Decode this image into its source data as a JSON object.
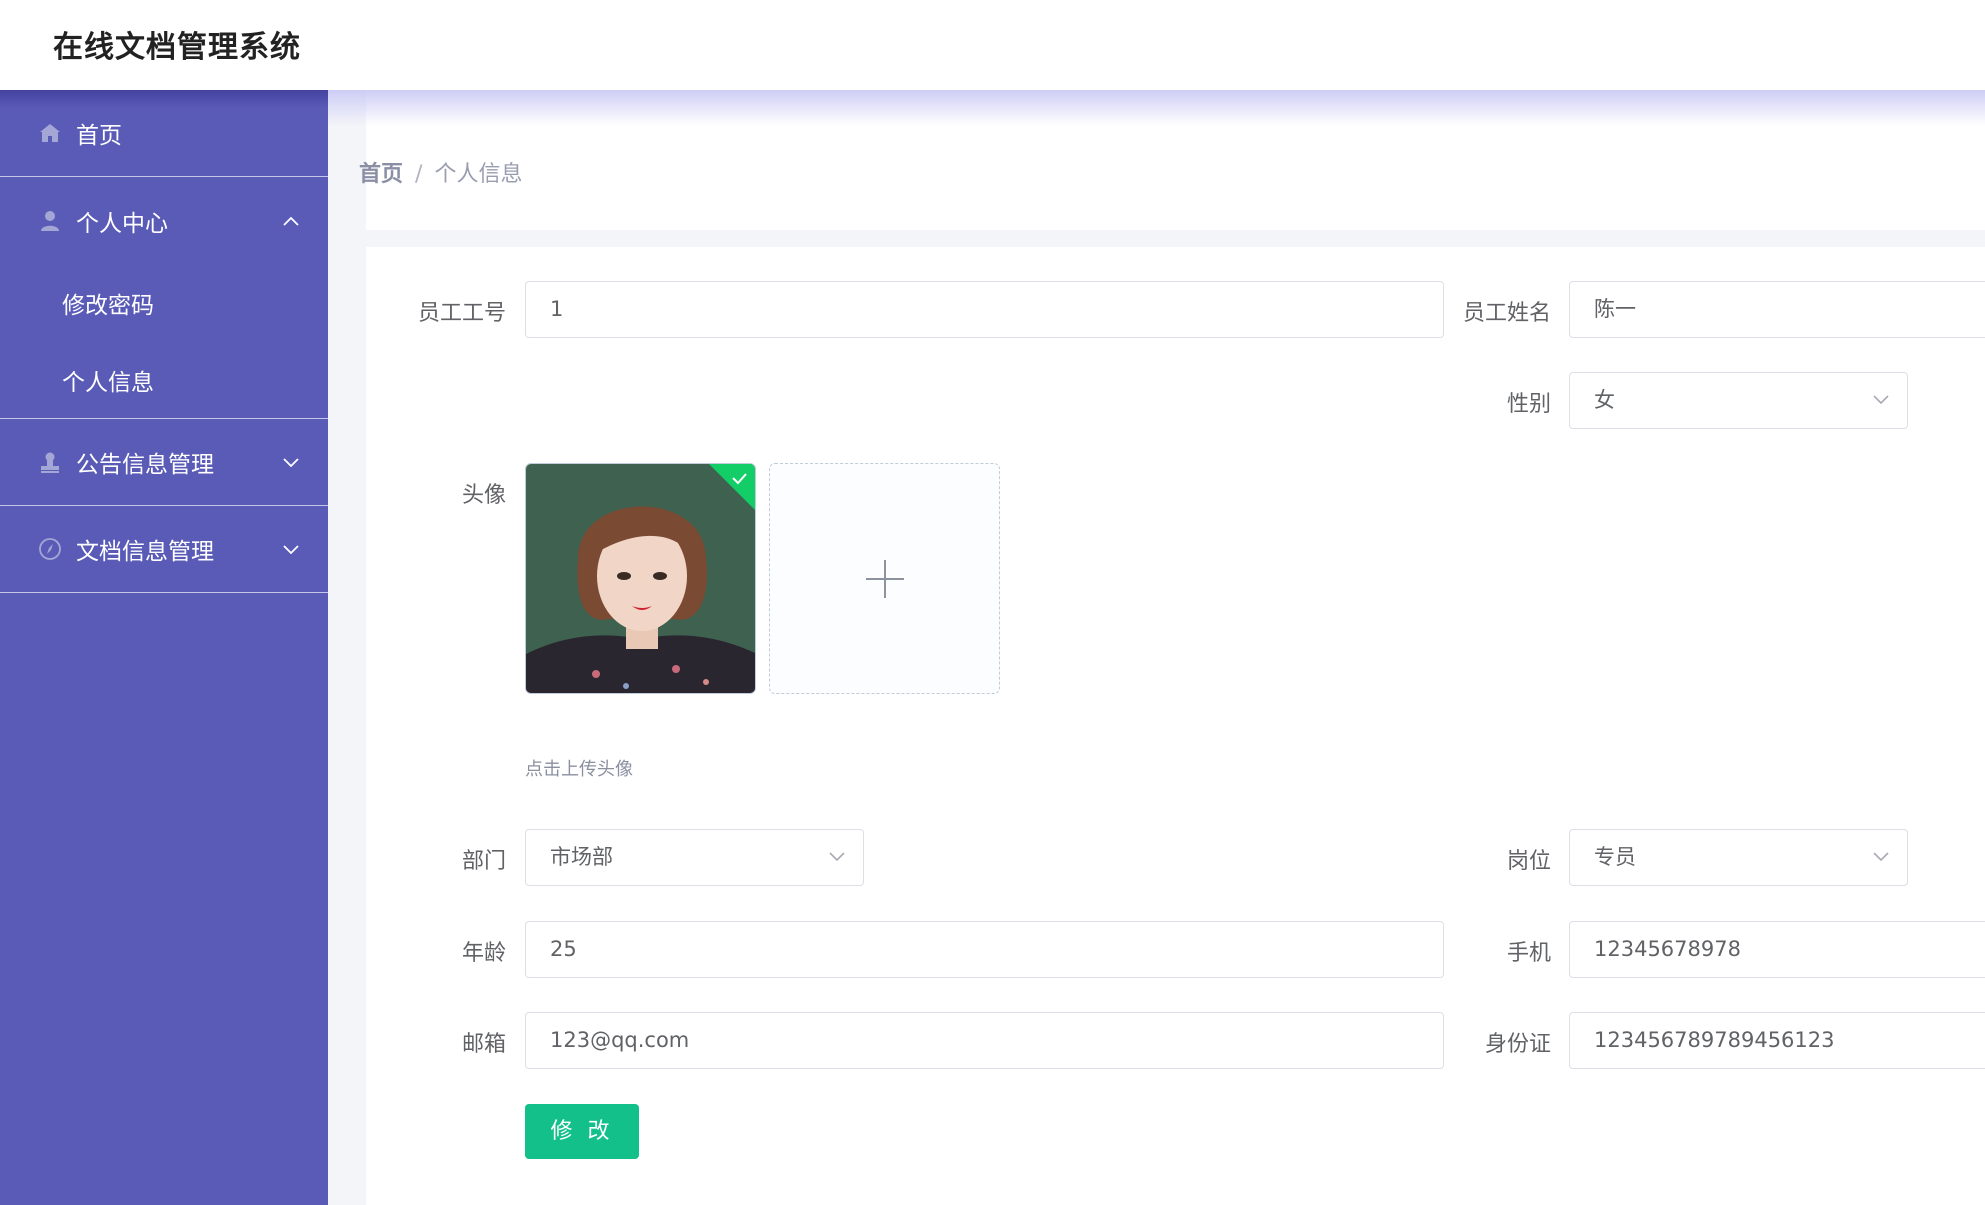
{
  "app": {
    "title": "在线文档管理系统"
  },
  "sidebar": {
    "items": [
      {
        "label": "首页",
        "icon": "home-icon"
      },
      {
        "label": "个人中心",
        "icon": "user-icon",
        "expanded": true,
        "children": [
          {
            "label": "修改密码"
          },
          {
            "label": "个人信息"
          }
        ]
      },
      {
        "label": "公告信息管理",
        "icon": "stamp-icon",
        "expanded": false
      },
      {
        "label": "文档信息管理",
        "icon": "compass-icon",
        "expanded": false
      }
    ]
  },
  "breadcrumb": {
    "home": "首页",
    "separator": "/",
    "current": "个人信息"
  },
  "form": {
    "employee_no": {
      "label": "员工工号",
      "value": "1"
    },
    "employee_name": {
      "label": "员工姓名",
      "value": "陈一"
    },
    "gender": {
      "label": "性别",
      "value": "女"
    },
    "avatar": {
      "label": "头像",
      "tip": "点击上传头像",
      "uploaded": true
    },
    "department": {
      "label": "部门",
      "value": "市场部"
    },
    "position": {
      "label": "岗位",
      "value": "专员"
    },
    "age": {
      "label": "年龄",
      "value": "25"
    },
    "phone": {
      "label": "手机",
      "value": "12345678978"
    },
    "email": {
      "label": "邮箱",
      "value": "123@qq.com"
    },
    "id_card": {
      "label": "身份证",
      "value": "123456789789456123"
    },
    "submit_label": "修 改"
  },
  "colors": {
    "sidebar_bg": "#5a5bb7",
    "primary_button": "#13c08a",
    "upload_success": "#13ce66"
  }
}
